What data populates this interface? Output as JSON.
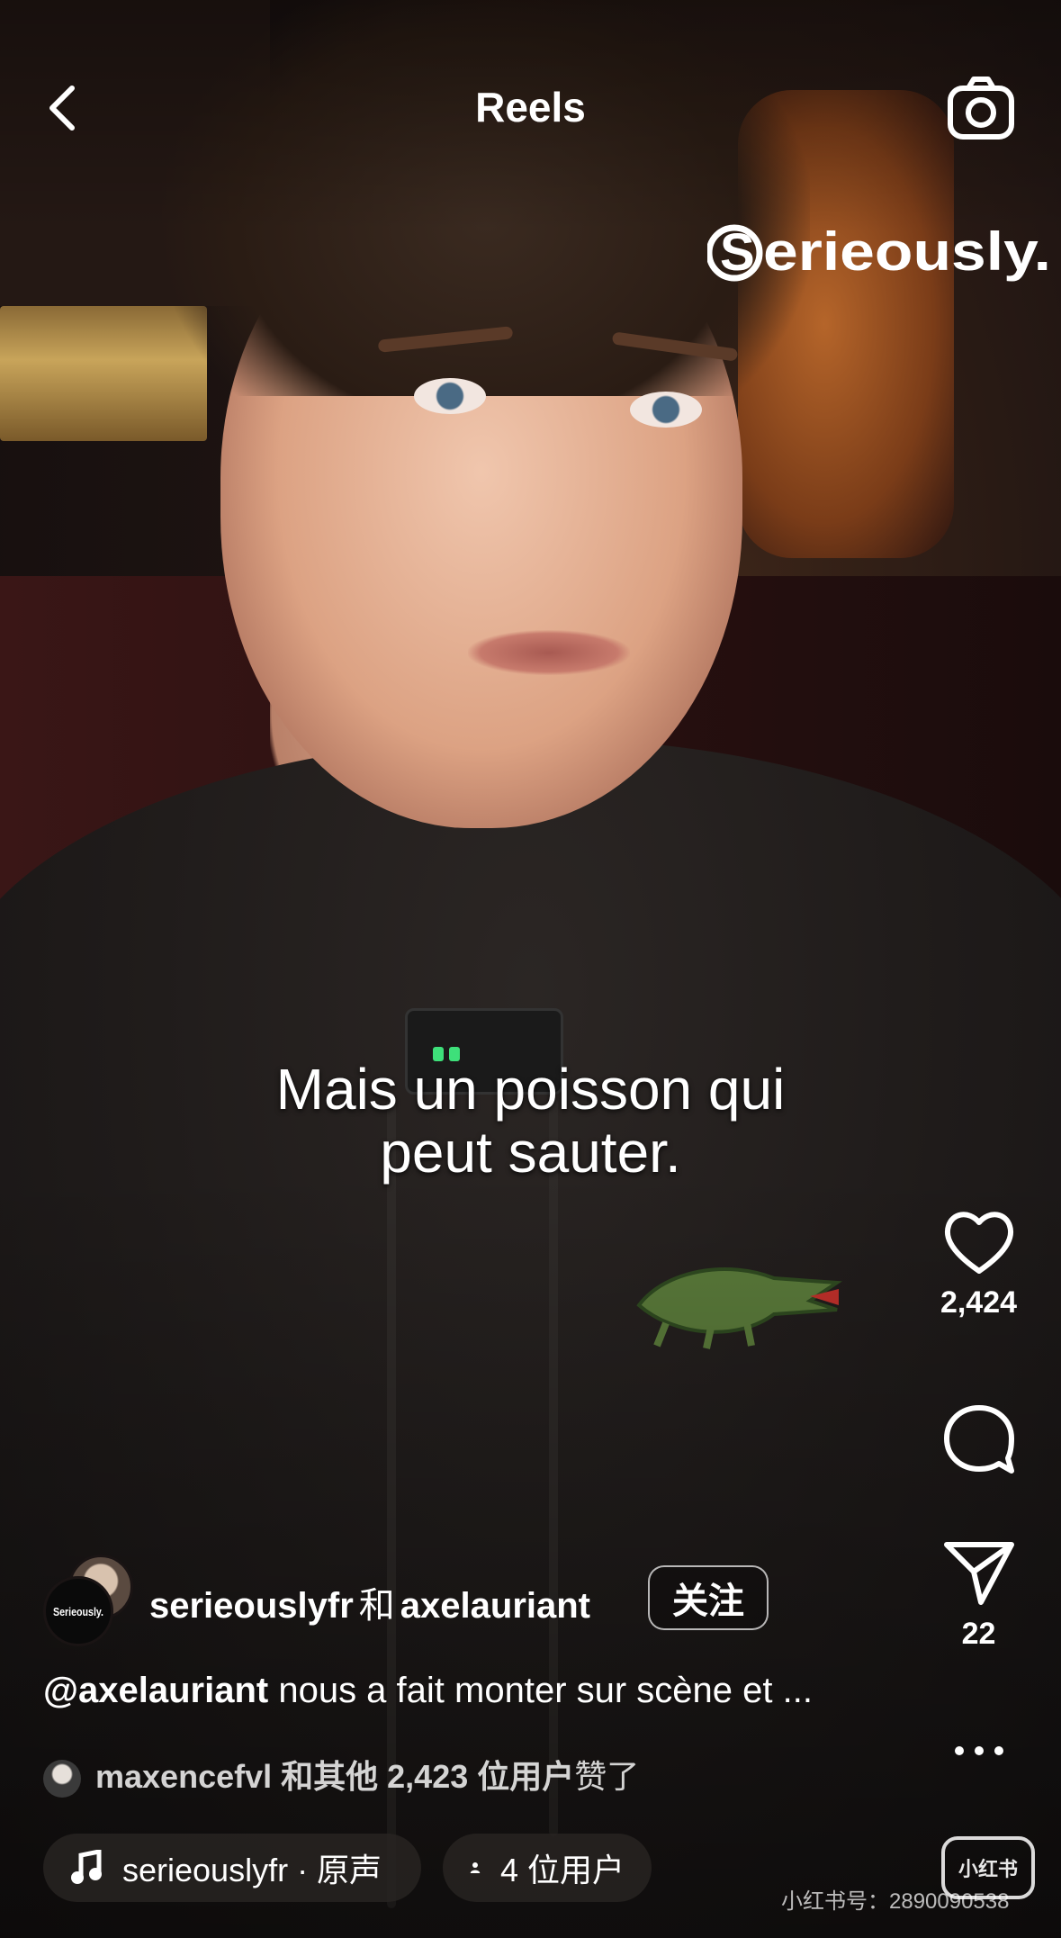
{
  "header": {
    "title": "Reels",
    "back_icon": "chevron-left-icon",
    "camera_icon": "camera-icon"
  },
  "video": {
    "subtitle_line1": "Mais un poisson qui",
    "subtitle_line2": "peut sauter."
  },
  "actions": {
    "like_count": "2,424",
    "share_count": "22"
  },
  "post": {
    "author1": "serieouslyfr",
    "and_label": "和",
    "author2": "axelauriant",
    "follow_label": "关注",
    "caption_mention": "@axelauriant",
    "caption_text": " nous a fait monter sur scène et ...",
    "liked_by_user": "maxencefvl",
    "liked_by_suffix": "和其他 2,423 位用户",
    "liked_by_verb": "赞了"
  },
  "footer": {
    "audio_label": "serieouslyfr · 原声",
    "users_label": "4 位用户",
    "watermark": "小红书号：2890090538"
  },
  "colors": {
    "text": "#ffffff",
    "pill_bg": "#282422"
  }
}
